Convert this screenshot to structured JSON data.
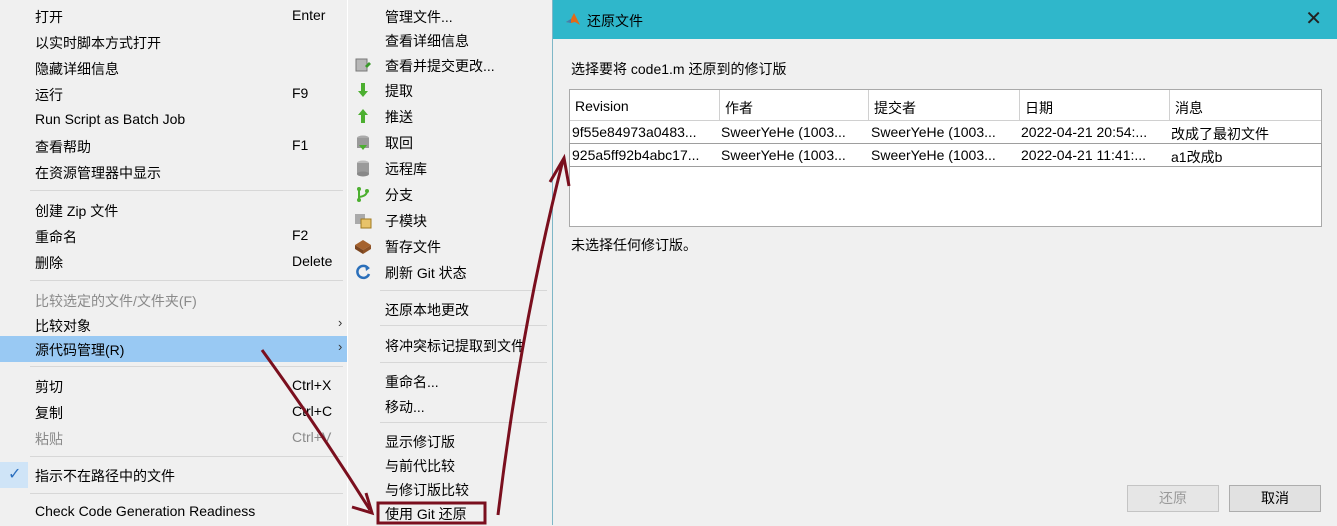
{
  "context_menu": {
    "items": [
      {
        "label": "打开",
        "shortcut": "Enter"
      },
      {
        "label": "以实时脚本方式打开",
        "shortcut": ""
      },
      {
        "label": "隐藏详细信息",
        "shortcut": ""
      },
      {
        "label": "运行",
        "shortcut": "F9"
      },
      {
        "label": "Run Script as Batch Job",
        "shortcut": ""
      },
      {
        "label": "查看帮助",
        "shortcut": "F1"
      },
      {
        "label": "在资源管理器中显示",
        "shortcut": ""
      },
      {
        "label": "创建 Zip 文件",
        "shortcut": ""
      },
      {
        "label": "重命名",
        "shortcut": "F2"
      },
      {
        "label": "删除",
        "shortcut": "Delete"
      },
      {
        "label": "比较选定的文件/文件夹(F)",
        "shortcut": ""
      },
      {
        "label": "比较对象",
        "shortcut": ""
      },
      {
        "label": "源代码管理(R)",
        "shortcut": ""
      },
      {
        "label": "剪切",
        "shortcut": "Ctrl+X"
      },
      {
        "label": "复制",
        "shortcut": "Ctrl+C"
      },
      {
        "label": "粘贴",
        "shortcut": "Ctrl+V"
      },
      {
        "label": "指示不在路径中的文件",
        "shortcut": ""
      },
      {
        "label": "Check Code Generation Readiness",
        "shortcut": ""
      }
    ]
  },
  "submenu": {
    "items": [
      {
        "label": "管理文件...",
        "icon": "none"
      },
      {
        "label": "查看详细信息",
        "icon": "none"
      },
      {
        "label": "查看并提交更改...",
        "icon": "commit-icon"
      },
      {
        "label": "提取",
        "icon": "fetch-icon"
      },
      {
        "label": "推送",
        "icon": "push-icon"
      },
      {
        "label": "取回",
        "icon": "pull-icon"
      },
      {
        "label": "远程库",
        "icon": "remote-icon"
      },
      {
        "label": "分支",
        "icon": "branch-icon"
      },
      {
        "label": "子模块",
        "icon": "submodule-icon"
      },
      {
        "label": "暂存文件",
        "icon": "stash-icon"
      },
      {
        "label": "刷新 Git 状态",
        "icon": "refresh-icon"
      },
      {
        "label": "还原本地更改",
        "icon": "none"
      },
      {
        "label": "将冲突标记提取到文件",
        "icon": "none"
      },
      {
        "label": "重命名...",
        "icon": "none"
      },
      {
        "label": "移动...",
        "icon": "none"
      },
      {
        "label": "显示修订版",
        "icon": "none"
      },
      {
        "label": "与前代比较",
        "icon": "none"
      },
      {
        "label": "与修订版比较",
        "icon": "none"
      },
      {
        "label": "使用 Git 还原",
        "icon": "none"
      }
    ]
  },
  "dialog": {
    "title": "还原文件",
    "prompt": "选择要将 code1.m 还原到的修订版",
    "columns": [
      "Revision",
      "作者",
      "提交者",
      "日期",
      "消息"
    ],
    "rows": [
      {
        "revision": "9f55e84973a0483...",
        "author": "SweerYeHe (1003...",
        "committer": "SweerYeHe (1003...",
        "date": "2022-04-21 20:54:...",
        "message": "改成了最初文件"
      },
      {
        "revision": "925a5ff92b4abc17...",
        "author": "SweerYeHe (1003...",
        "committer": "SweerYeHe (1003...",
        "date": "2022-04-21 11:41:...",
        "message": "a1改成b"
      }
    ],
    "status": "未选择任何修订版。",
    "revert_button": "还原",
    "cancel_button": "取消",
    "close_glyph": "✕"
  },
  "colors": {
    "titlebar": "#2fb7cb",
    "highlight": "#99c9f3",
    "annotation": "#7a0f1e"
  }
}
